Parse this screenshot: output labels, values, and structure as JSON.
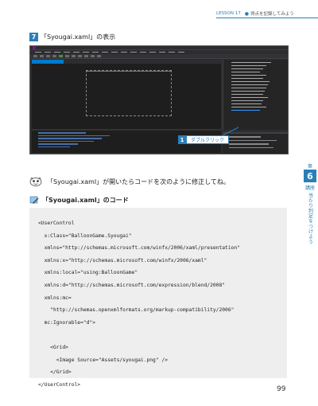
{
  "header": {
    "lesson": "LESSON 17",
    "title": "得点を記録してみよう"
  },
  "section": {
    "number": "7",
    "title": "「Syougai.xaml」の表示"
  },
  "callout": {
    "number": "1",
    "text": "ダブルクリック"
  },
  "note": {
    "text": "「Syougai.xaml」が開いたらコードを次のように修正してね。"
  },
  "code_heading": "「Syougai.xaml」のコード",
  "code_lines": [
    "<UserControl",
    "  x:Class=\"BalloonGame.Syougai\"",
    "  xmlns=\"http://schemas.microsoft.com/winfx/2006/xaml/presentation\"",
    "  xmlns:x=\"http://schemas.microsoft.com/winfx/2006/xaml\"",
    "  xmlns:local=\"using:BalloonGame\"",
    "  xmlns:d=\"http://schemas.microsoft.com/expression/blend/2008\"",
    "  xmlns:mc=",
    "    \"http://schemas.openxmlformats.org/markup-compatibility/2006\"",
    "  mc:Ignorable=\"d\">",
    "",
    "    <Grid>",
    "      <Image Source=\"Assets/syougai.png\" />",
    "    </Grid>",
    "</UserControl>"
  ],
  "chapter": {
    "label_top": "第",
    "number": "6",
    "label_bottom": "講座",
    "subtitle": "当たり判定をつけよう"
  },
  "page_number": "99",
  "colors": {
    "accent": "#2a7fb8",
    "code_bg": "#eeeeee",
    "ide_bg": "#2d2d30"
  }
}
